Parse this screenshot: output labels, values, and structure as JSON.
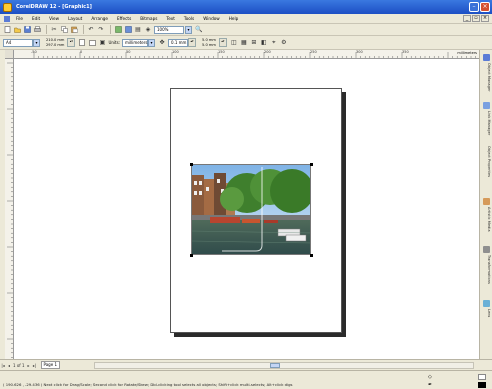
{
  "window": {
    "title": "CorelDRAW 12 - [Graphic1]"
  },
  "menu": {
    "items": [
      "File",
      "Edit",
      "View",
      "Layout",
      "Arrange",
      "Effects",
      "Bitmaps",
      "Text",
      "Tools",
      "Window",
      "Help"
    ]
  },
  "toolbar": {
    "zoom_value": "100%"
  },
  "property_bar": {
    "paper_size": "A4",
    "width": "210.0 mm",
    "height": "297.0 mm",
    "units_label": "Units:",
    "units_value": "millimeters",
    "nudge": "0.1 mm",
    "duplicate_x": "5.0 mm",
    "duplicate_y": "5.0 mm"
  },
  "ruler": {
    "top_ticks": [
      "-50",
      "0",
      "50",
      "100",
      "150",
      "200",
      "250",
      "300",
      "350"
    ],
    "unit": "millimeters"
  },
  "dockers": {
    "tabs": [
      "Object Manager",
      "Link Manager",
      "Object Properties",
      "Artistic Media",
      "Transformations",
      "Lens"
    ]
  },
  "page_tabs": {
    "current": "Page 1",
    "counter": "1 of 1"
  },
  "status": {
    "text": "( 190.626 , -29.436 )   Next click for Drag/Scale; Second click for Rotate/Skew; Dbl-clicking tool selects all objects; Shift+click multi-selects; Alt+click digs"
  },
  "colors": {
    "title_bar": "#1c4fc4",
    "chrome": "#ece9d8",
    "canvas": "#ffffff"
  }
}
